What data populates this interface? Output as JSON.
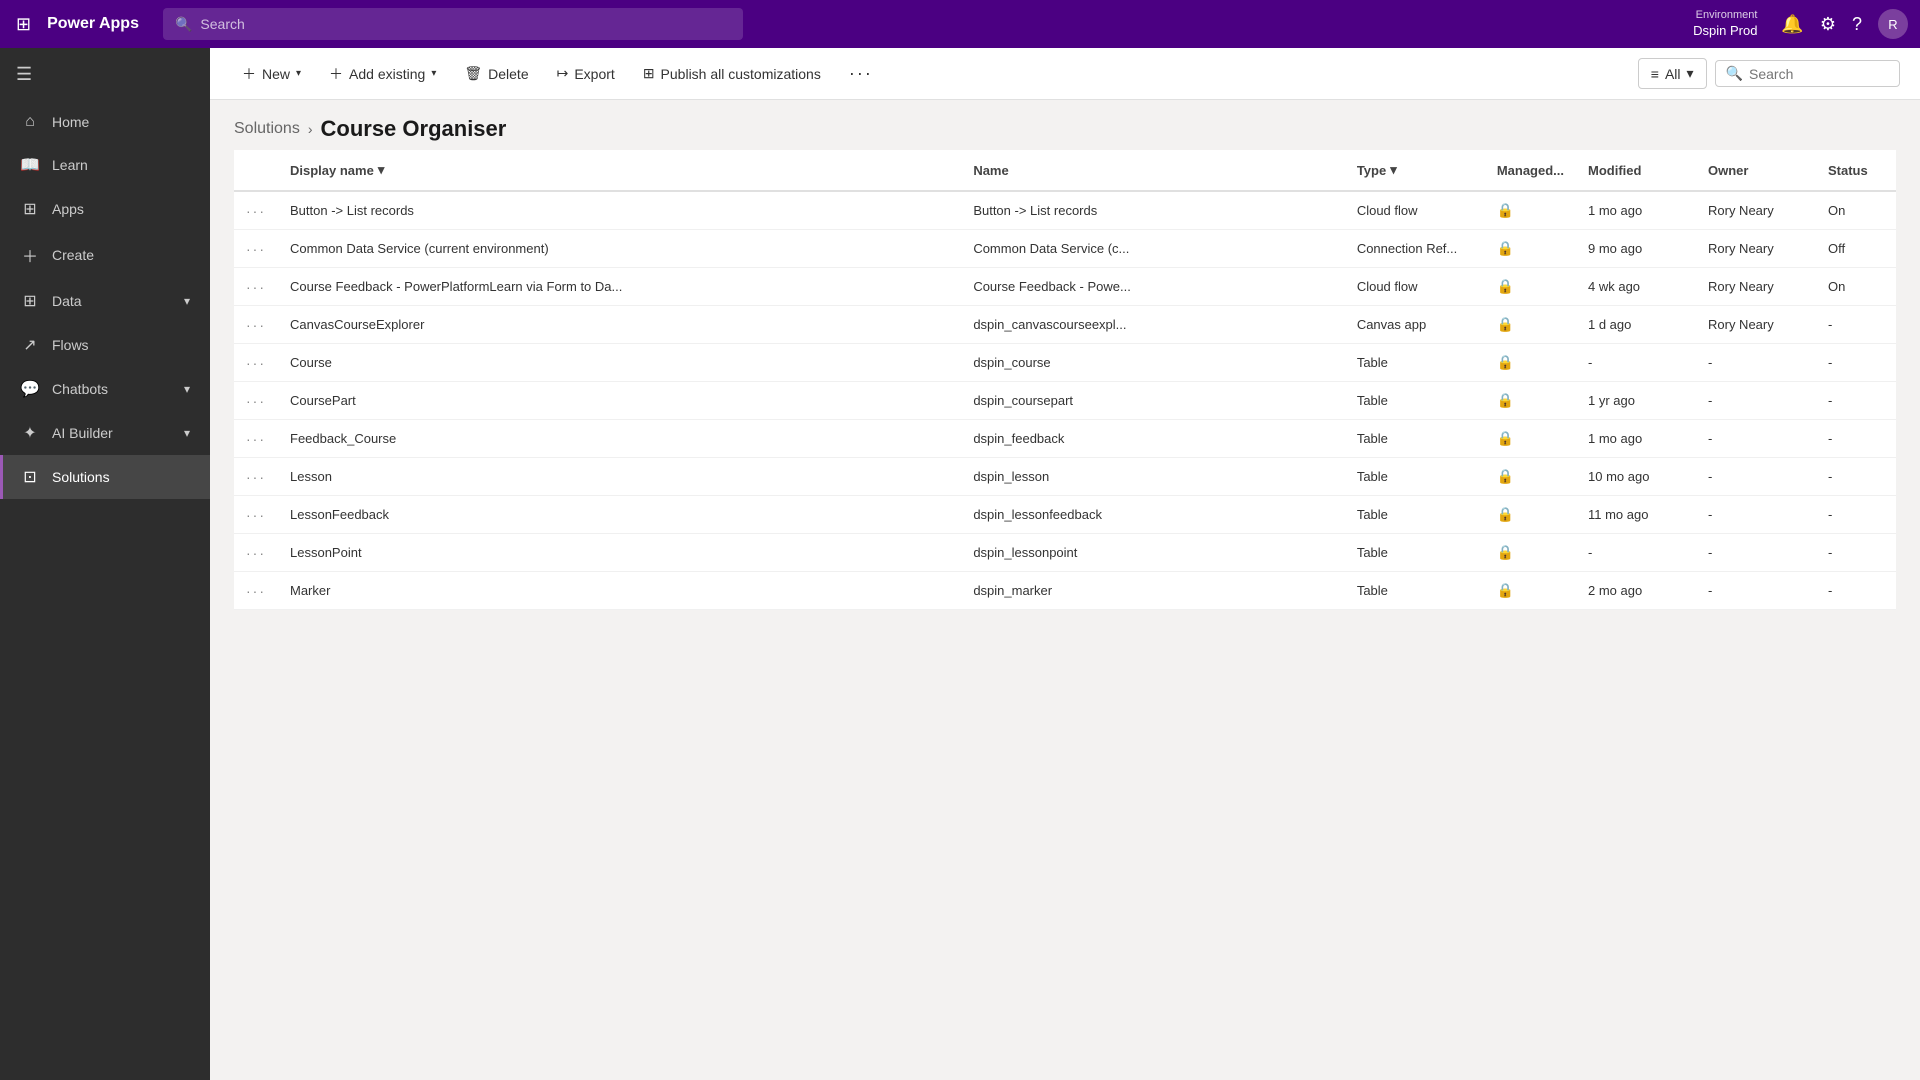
{
  "topNav": {
    "waffleIcon": "⊞",
    "appTitle": "Power Apps",
    "searchPlaceholder": "Search",
    "environment": {
      "label": "Environment",
      "name": "Dspin Prod"
    },
    "avatarInitial": "R"
  },
  "sidebar": {
    "items": [
      {
        "id": "home",
        "label": "Home",
        "icon": "⌂",
        "hasChevron": false,
        "active": false
      },
      {
        "id": "learn",
        "label": "Learn",
        "icon": "📖",
        "hasChevron": false,
        "active": false
      },
      {
        "id": "apps",
        "label": "Apps",
        "icon": "⊞",
        "hasChevron": false,
        "active": false
      },
      {
        "id": "create",
        "label": "Create",
        "icon": "+",
        "hasChevron": false,
        "active": false
      },
      {
        "id": "data",
        "label": "Data",
        "icon": "⊞",
        "hasChevron": true,
        "active": false
      },
      {
        "id": "flows",
        "label": "Flows",
        "icon": "↗",
        "hasChevron": false,
        "active": false
      },
      {
        "id": "chatbots",
        "label": "Chatbots",
        "icon": "💬",
        "hasChevron": true,
        "active": false
      },
      {
        "id": "ai-builder",
        "label": "AI Builder",
        "icon": "✦",
        "hasChevron": true,
        "active": false
      },
      {
        "id": "solutions",
        "label": "Solutions",
        "icon": "⊡",
        "hasChevron": false,
        "active": true
      }
    ]
  },
  "toolbar": {
    "newLabel": "New",
    "addExistingLabel": "Add existing",
    "deleteLabel": "Delete",
    "exportLabel": "Export",
    "publishLabel": "Publish all customizations",
    "moreLabel": "···",
    "filterLabel": "All",
    "searchPlaceholder": "Search"
  },
  "breadcrumb": {
    "parentLabel": "Solutions",
    "currentLabel": "Course Organiser"
  },
  "table": {
    "columns": [
      {
        "id": "actions",
        "label": ""
      },
      {
        "id": "displayName",
        "label": "Display name",
        "sortable": true
      },
      {
        "id": "name",
        "label": "Name"
      },
      {
        "id": "type",
        "label": "Type",
        "sortable": true
      },
      {
        "id": "managed",
        "label": "Managed..."
      },
      {
        "id": "modified",
        "label": "Modified"
      },
      {
        "id": "owner",
        "label": "Owner"
      },
      {
        "id": "status",
        "label": "Status"
      }
    ],
    "rows": [
      {
        "displayName": "Button -> List records",
        "name": "Button -> List records",
        "type": "Cloud flow",
        "managed": true,
        "modified": "1 mo ago",
        "owner": "Rory Neary",
        "status": "On"
      },
      {
        "displayName": "Common Data Service (current environment)",
        "name": "Common Data Service (c...",
        "type": "Connection Ref...",
        "managed": true,
        "modified": "9 mo ago",
        "owner": "Rory Neary",
        "status": "Off"
      },
      {
        "displayName": "Course Feedback - PowerPlatformLearn via Form to Da...",
        "name": "Course Feedback - Powe...",
        "type": "Cloud flow",
        "managed": true,
        "modified": "4 wk ago",
        "owner": "Rory Neary",
        "status": "On"
      },
      {
        "displayName": "CanvasCourseExplorer",
        "name": "dspin_canvascourseexpl...",
        "type": "Canvas app",
        "managed": true,
        "modified": "1 d ago",
        "owner": "Rory Neary",
        "status": "-"
      },
      {
        "displayName": "Course",
        "name": "dspin_course",
        "type": "Table",
        "managed": true,
        "modified": "-",
        "owner": "-",
        "status": "-"
      },
      {
        "displayName": "CoursePart",
        "name": "dspin_coursepart",
        "type": "Table",
        "managed": true,
        "modified": "1 yr ago",
        "owner": "-",
        "status": "-"
      },
      {
        "displayName": "Feedback_Course",
        "name": "dspin_feedback",
        "type": "Table",
        "managed": true,
        "modified": "1 mo ago",
        "owner": "-",
        "status": "-"
      },
      {
        "displayName": "Lesson",
        "name": "dspin_lesson",
        "type": "Table",
        "managed": true,
        "modified": "10 mo ago",
        "owner": "-",
        "status": "-"
      },
      {
        "displayName": "LessonFeedback",
        "name": "dspin_lessonfeedback",
        "type": "Table",
        "managed": true,
        "modified": "11 mo ago",
        "owner": "-",
        "status": "-"
      },
      {
        "displayName": "LessonPoint",
        "name": "dspin_lessonpoint",
        "type": "Table",
        "managed": true,
        "modified": "-",
        "owner": "-",
        "status": "-"
      },
      {
        "displayName": "Marker",
        "name": "dspin_marker",
        "type": "Table",
        "managed": true,
        "modified": "2 mo ago",
        "owner": "-",
        "status": "-"
      }
    ]
  }
}
